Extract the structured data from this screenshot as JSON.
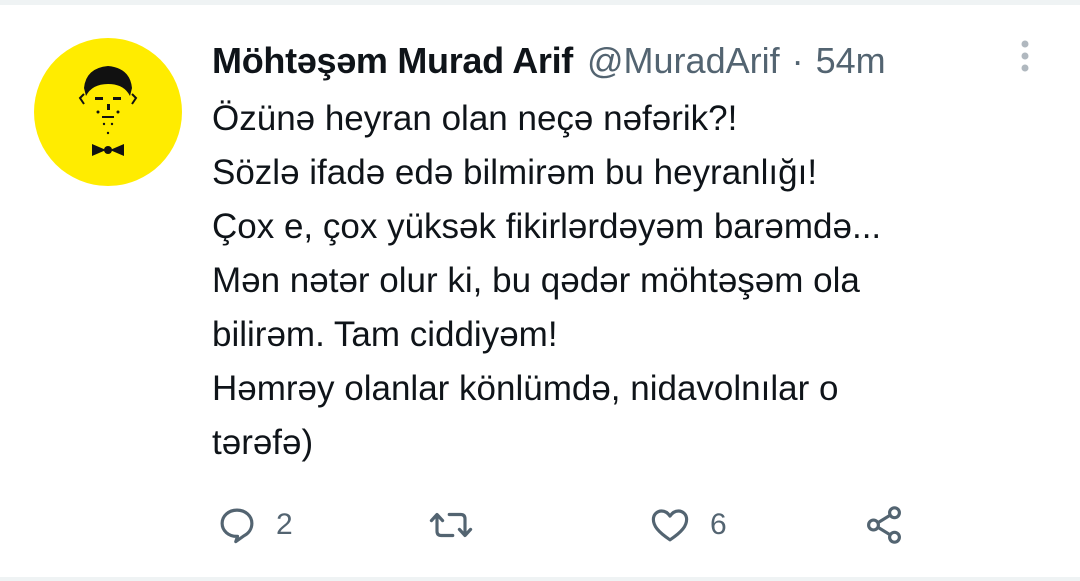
{
  "tweet": {
    "author_name": "Möhtəşəm Murad Arif",
    "author_handle": "@MuradArif",
    "separator": "·",
    "timestamp": "54m",
    "lines": [
      "Özünə heyran olan neçə nəfərik?!",
      "Sözlə ifadə edə bilmirəm bu heyranlığı!",
      "Çox e, çox yüksək fikirlərdəyəm barəmdə...",
      "Mən nətər olur ki, bu qədər möhtəşəm ola",
      "bilirəm. Tam ciddiyəm!",
      "Həmrəy olanlar könlümdə, nidavolnılar o",
      "tərəfə)"
    ]
  },
  "actions": {
    "reply_count": "2",
    "retweet_count": "",
    "like_count": "6"
  },
  "icons": {
    "avatar": "bowtie-man-avatar",
    "more": "vertical-ellipsis-icon",
    "reply": "speech-bubble-icon",
    "retweet": "retweet-arrows-icon",
    "like": "heart-icon",
    "share": "share-nodes-icon"
  },
  "colors": {
    "text_primary": "#0f1419",
    "text_secondary": "#536471",
    "avatar_background": "#ffec00",
    "divider": "#eff3f4"
  }
}
